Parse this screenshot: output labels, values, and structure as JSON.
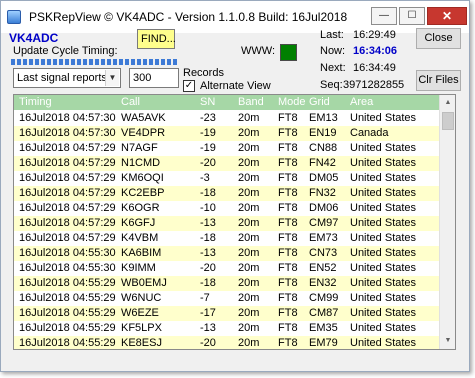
{
  "window": {
    "title": "PSKRepView © VK4ADC - Version 1.1.0.8  Build: 16Jul2018",
    "minimize_glyph": "—",
    "maximize_glyph": "☐",
    "close_glyph": "✕"
  },
  "header": {
    "callsign": "VK4ADC",
    "update_cycle_label": "Update Cycle Timing:",
    "update_cycle_progress": 1.0,
    "find_label": "FIND...",
    "www_label": "WWW:",
    "www_status_color": "#008000",
    "last_label": "Last:",
    "last_time": "16:29:49",
    "now_label": "Now:",
    "now_time": "16:34:06",
    "next_label": "Next:",
    "next_time": "16:34:49",
    "seq_label": "Seq:",
    "seq_value": "3971282855",
    "close_button": "Close",
    "clear_files_button": "Clr Files"
  },
  "controls": {
    "filter_select_value": "Last signal reports",
    "record_count": "300",
    "records_label": "Records",
    "alternate_view_label": "Alternate View",
    "alternate_view_checked": true,
    "checkmark": "✓"
  },
  "table": {
    "columns": [
      "Timing",
      "Call",
      "SN",
      "Band",
      "Mode",
      "Grid",
      "Area"
    ],
    "rows": [
      [
        "16Jul2018 04:57:30",
        "WA5AVK",
        "-23",
        "20m",
        "FT8",
        "EM13",
        "United States"
      ],
      [
        "16Jul2018 04:57:30",
        "VE4DPR",
        "-19",
        "20m",
        "FT8",
        "EN19",
        "Canada"
      ],
      [
        "16Jul2018 04:57:29",
        "N7AGF",
        "-19",
        "20m",
        "FT8",
        "CN88",
        "United States"
      ],
      [
        "16Jul2018 04:57:29",
        "N1CMD",
        "-20",
        "20m",
        "FT8",
        "FN42",
        "United States"
      ],
      [
        "16Jul2018 04:57:29",
        "KM6OQI",
        "-3",
        "20m",
        "FT8",
        "DM05",
        "United States"
      ],
      [
        "16Jul2018 04:57:29",
        "KC2EBP",
        "-18",
        "20m",
        "FT8",
        "FN32",
        "United States"
      ],
      [
        "16Jul2018 04:57:29",
        "K6OGR",
        "-10",
        "20m",
        "FT8",
        "DM06",
        "United States"
      ],
      [
        "16Jul2018 04:57:29",
        "K6GFJ",
        "-13",
        "20m",
        "FT8",
        "CM97",
        "United States"
      ],
      [
        "16Jul2018 04:57:29",
        "K4VBM",
        "-18",
        "20m",
        "FT8",
        "EM73",
        "United States"
      ],
      [
        "16Jul2018 04:55:30",
        "KA6BIM",
        "-13",
        "20m",
        "FT8",
        "CN73",
        "United States"
      ],
      [
        "16Jul2018 04:55:30",
        "K9IMM",
        "-20",
        "20m",
        "FT8",
        "EN52",
        "United States"
      ],
      [
        "16Jul2018 04:55:29",
        "WB0EMJ",
        "-18",
        "20m",
        "FT8",
        "EN32",
        "United States"
      ],
      [
        "16Jul2018 04:55:29",
        "W6NUC",
        "-7",
        "20m",
        "FT8",
        "CM99",
        "United States"
      ],
      [
        "16Jul2018 04:55:29",
        "W6EZE",
        "-17",
        "20m",
        "FT8",
        "CM87",
        "United States"
      ],
      [
        "16Jul2018 04:55:29",
        "KF5LPX",
        "-13",
        "20m",
        "FT8",
        "EM35",
        "United States"
      ],
      [
        "16Jul2018 04:55:29",
        "KE8ESJ",
        "-20",
        "20m",
        "FT8",
        "EM79",
        "United States"
      ]
    ],
    "scroll_up_glyph": "▲",
    "scroll_down_glyph": "▼"
  }
}
